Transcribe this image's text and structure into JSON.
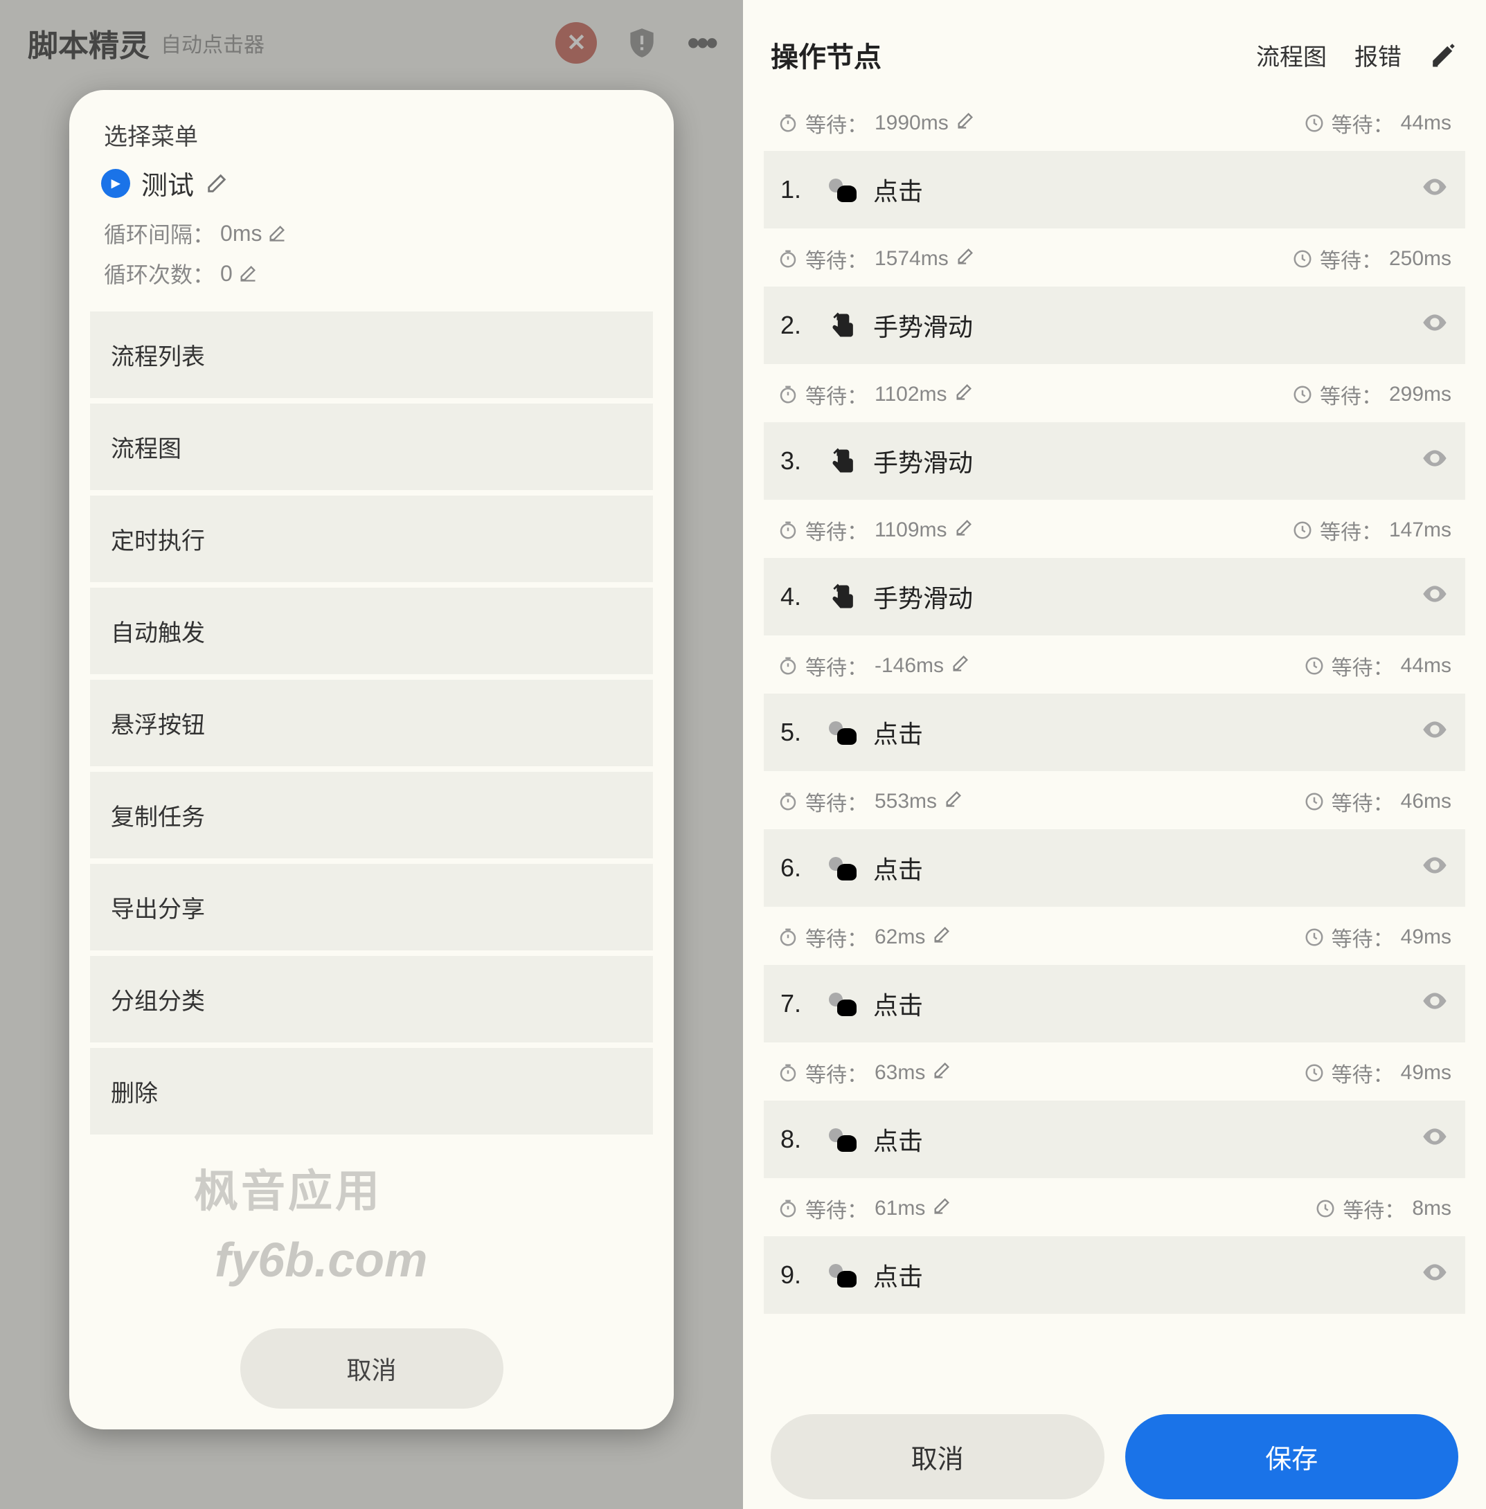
{
  "screen1": {
    "header": {
      "title": "脚本精灵",
      "subtitle": "自动点击器"
    },
    "dialog": {
      "title": "选择菜单",
      "name": "测试",
      "loop_interval_label": "循环间隔：",
      "loop_interval_value": "0ms",
      "loop_count_label": "循环次数：",
      "loop_count_value": "0",
      "menu": [
        "流程列表",
        "流程图",
        "定时执行",
        "自动触发",
        "悬浮按钮",
        "复制任务",
        "导出分享",
        "分组分类",
        "删除"
      ],
      "cancel": "取消"
    }
  },
  "screen2": {
    "header": {
      "title": "操作节点",
      "tab_flow": "流程图",
      "tab_report": "报错"
    },
    "wait_label": "等待：",
    "steps": [
      {
        "num": "1.",
        "type": "tap",
        "label": "点击",
        "pre": "1990ms",
        "post": "44ms"
      },
      {
        "num": "2.",
        "type": "swipe",
        "label": "手势滑动",
        "pre": "1574ms",
        "post": "250ms"
      },
      {
        "num": "3.",
        "type": "swipe",
        "label": "手势滑动",
        "pre": "1102ms",
        "post": "299ms"
      },
      {
        "num": "4.",
        "type": "swipe",
        "label": "手势滑动",
        "pre": "1109ms",
        "post": "147ms"
      },
      {
        "num": "5.",
        "type": "tap",
        "label": "点击",
        "pre": "-146ms",
        "post": "44ms"
      },
      {
        "num": "6.",
        "type": "tap",
        "label": "点击",
        "pre": "553ms",
        "post": "46ms"
      },
      {
        "num": "7.",
        "type": "tap",
        "label": "点击",
        "pre": "62ms",
        "post": "49ms"
      },
      {
        "num": "8.",
        "type": "tap",
        "label": "点击",
        "pre": "63ms",
        "post": "49ms"
      },
      {
        "num": "9.",
        "type": "tap",
        "label": "点击",
        "pre": "61ms",
        "post": "8ms"
      }
    ],
    "cancel": "取消",
    "save": "保存"
  },
  "watermark": {
    "line1": "枫音应用",
    "line2": "fy6b.com"
  }
}
